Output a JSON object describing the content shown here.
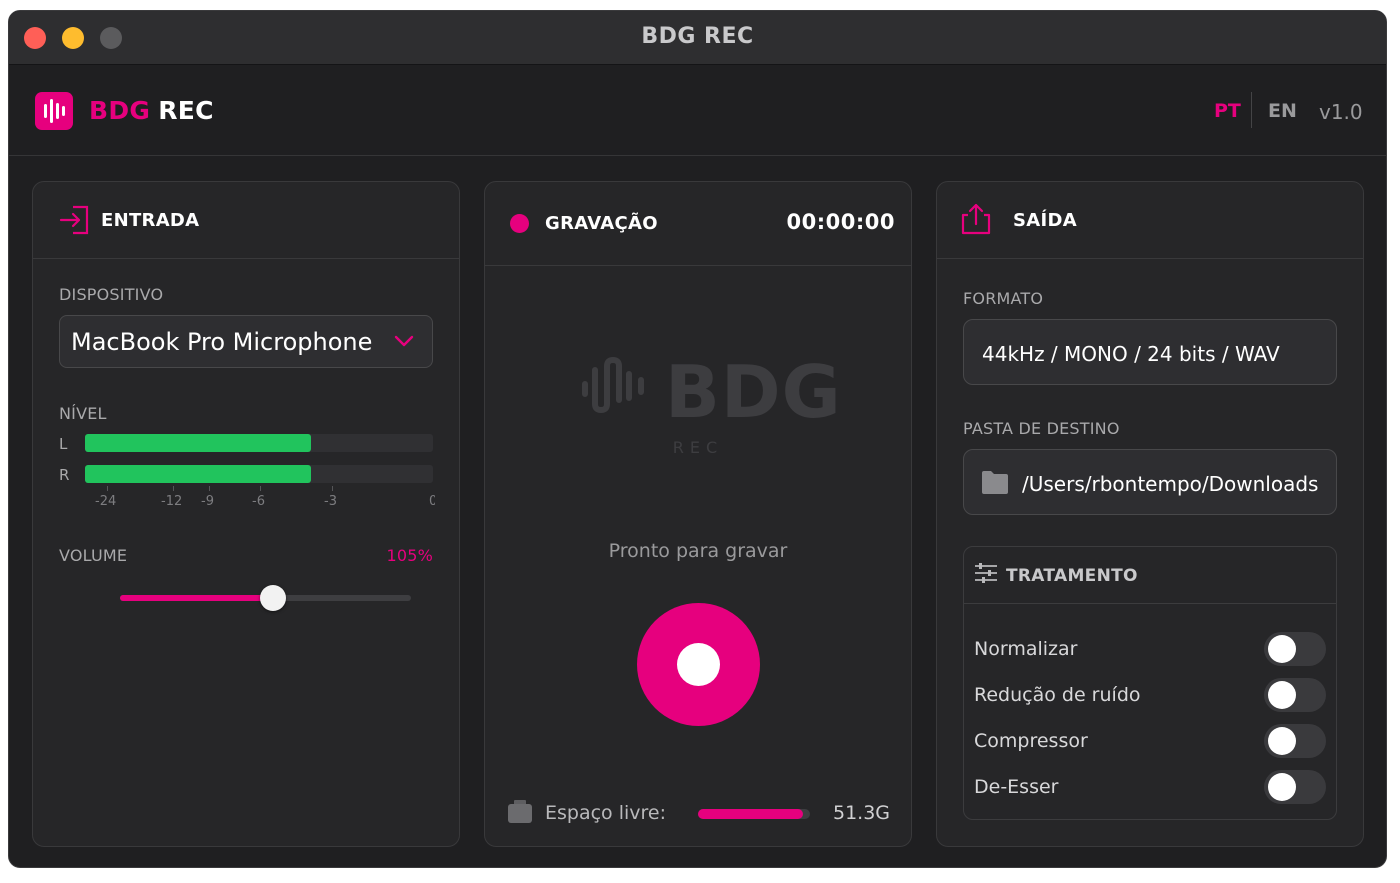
{
  "window": {
    "title": "BDG REC"
  },
  "app": {
    "brand_primary": "BDG",
    "brand_secondary": "REC",
    "lang_pt": "PT",
    "lang_en": "EN",
    "version": "v1.0",
    "accent_color": "#e6007e",
    "meter_color": "#21c45d"
  },
  "input_panel": {
    "title": "ENTRADA",
    "device_label": "DISPOSITIVO",
    "device_value": "MacBook Pro Microphone",
    "level_label": "NÍVEL",
    "channel_left": "L",
    "channel_right": "R",
    "level_left_fraction": 0.65,
    "level_right_fraction": 0.65,
    "scale_ticks": [
      "-24",
      "-12",
      "-9",
      "-6",
      "-3",
      "0"
    ],
    "volume_label": "VOLUME",
    "volume_value": "105%",
    "volume_fraction": 0.525
  },
  "record_panel": {
    "title": "GRAVAÇÃO",
    "timer": "00:00:00",
    "watermark_main": "BDG",
    "watermark_sub": "REC",
    "status": "Pronto para gravar",
    "free_space_label": "Espaço livre:",
    "free_space_value": "51.3G",
    "free_space_fraction": 0.94
  },
  "output_panel": {
    "title": "SAÍDA",
    "format_label": "FORMATO",
    "format_value": "44kHz / MONO / 24 bits / WAV",
    "folder_label": "PASTA DE DESTINO",
    "folder_value": "/Users/rbontempo/Downloads",
    "treatment_title": "TRATAMENTO",
    "toggles": [
      {
        "label": "Normalizar",
        "on": false
      },
      {
        "label": "Redução de ruído",
        "on": false
      },
      {
        "label": "Compressor",
        "on": false
      },
      {
        "label": "De-Esser",
        "on": false
      }
    ]
  }
}
